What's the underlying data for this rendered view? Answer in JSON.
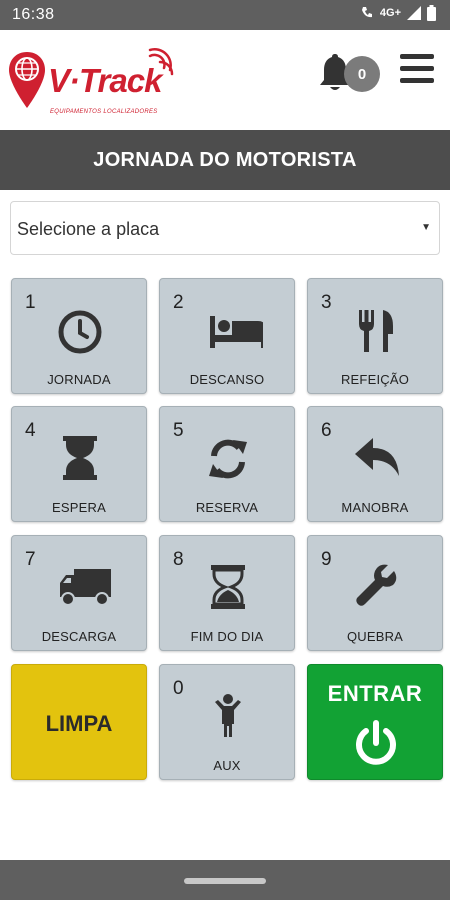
{
  "status_bar": {
    "time": "16:38",
    "network": "4G+"
  },
  "header": {
    "logo_text": "V·Track",
    "logo_tagline": "EQUIPAMENTOS LOCALIZADORES",
    "notification_count": "0"
  },
  "title": "JORNADA DO MOTORISTA",
  "plate_select": {
    "placeholder": "Selecione a placa"
  },
  "keys": [
    {
      "num": "1",
      "label": "JORNADA",
      "icon": "clock-icon"
    },
    {
      "num": "2",
      "label": "DESCANSO",
      "icon": "bed-icon"
    },
    {
      "num": "3",
      "label": "REFEIÇÃO",
      "icon": "utensils-icon"
    },
    {
      "num": "4",
      "label": "ESPERA",
      "icon": "hourglass-icon"
    },
    {
      "num": "5",
      "label": "RESERVA",
      "icon": "refresh-icon"
    },
    {
      "num": "6",
      "label": "MANOBRA",
      "icon": "reply-arrow-icon"
    },
    {
      "num": "7",
      "label": "DESCARGA",
      "icon": "truck-icon"
    },
    {
      "num": "8",
      "label": "FIM DO DIA",
      "icon": "hourglass-end-icon"
    },
    {
      "num": "9",
      "label": "QUEBRA",
      "icon": "wrench-icon"
    },
    {
      "num": "0",
      "label": "AUX",
      "icon": "child-icon"
    }
  ],
  "clear_button": {
    "label": "LIMPA",
    "color": "#e3c30e"
  },
  "enter_button": {
    "label": "ENTRAR",
    "icon": "power-icon",
    "color": "#12a234"
  },
  "colors": {
    "key_bg": "#c4cdd3",
    "title_bar": "#4d4d4d",
    "brand": "#cf2030"
  }
}
